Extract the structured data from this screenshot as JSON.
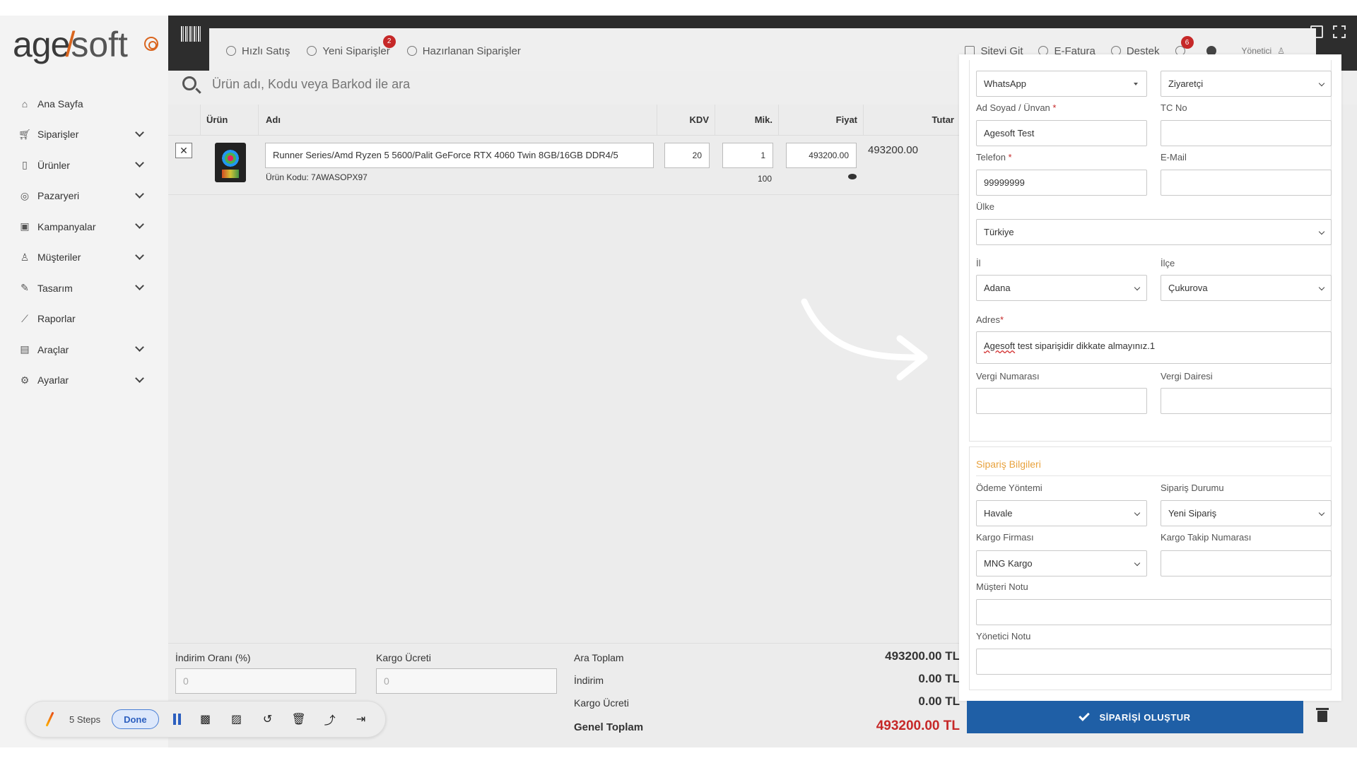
{
  "sidebar": {
    "logo_main": "age",
    "logo_slash": "/",
    "logo_soft": "soft",
    "items": [
      {
        "label": "Ana Sayfa",
        "icon": "home-icon",
        "expandable": false
      },
      {
        "label": "Siparişler",
        "icon": "cart-icon",
        "expandable": true
      },
      {
        "label": "Ürünler",
        "icon": "book-icon",
        "expandable": true
      },
      {
        "label": "Pazaryeri",
        "icon": "store-icon",
        "expandable": true
      },
      {
        "label": "Kampanyalar",
        "icon": "gift-icon",
        "expandable": true
      },
      {
        "label": "Müşteriler",
        "icon": "user-icon",
        "expandable": true
      },
      {
        "label": "Tasarım",
        "icon": "edit-icon",
        "expandable": true
      },
      {
        "label": "Raporlar",
        "icon": "chart-icon",
        "expandable": false
      },
      {
        "label": "Araçlar",
        "icon": "clipboard-icon",
        "expandable": true
      },
      {
        "label": "Ayarlar",
        "icon": "gear-icon",
        "expandable": true
      }
    ]
  },
  "toolbar": {
    "quick_sale": "Hızlı Satış",
    "new_orders": "Yeni Siparişler",
    "new_orders_badge": "2",
    "prepared_orders": "Hazırlanan Siparişler",
    "go_site": "Siteyi Git",
    "e_invoice": "E-Fatura",
    "support": "Destek",
    "notif_badge": "6",
    "user": "Yönetici"
  },
  "search": {
    "placeholder": "Ürün adı, Kodu veya Barkod ile ara"
  },
  "table": {
    "headers": {
      "urun": "Ürün",
      "adi": "Adı",
      "kdv": "KDV",
      "mik": "Mik.",
      "fiyat": "Fiyat",
      "tutar": "Tutar"
    },
    "rows": [
      {
        "name": "Runner Series/Amd Ryzen 5 5600/Palit GeForce RTX 4060 Twin 8GB/16GB DDR4/5",
        "code": "Ürün Kodu: 7AWASOPX97",
        "kdv": "20",
        "qty": "1",
        "stock": "100",
        "price": "493200.00",
        "total": "493200.00"
      }
    ]
  },
  "totals": {
    "discount_label": "İndirim Oranı (%)",
    "discount_value": "0",
    "shipping_fee_label": "Kargo Ücreti",
    "shipping_fee_value": "0",
    "subtotal_label": "Ara Toplam",
    "subtotal": "493200.00 TL",
    "discount_row_label": "İndirim",
    "discount_amount": "0.00 TL",
    "shipping_row_label": "Kargo Ücreti",
    "shipping_amount": "0.00 TL",
    "grand_label": "Genel Toplam",
    "grand_total": "493200.00 TL"
  },
  "customer": {
    "source": "WhatsApp",
    "type": "Ziyaretçi",
    "name_label": "Ad Soyad / Ünvan",
    "name": "Agesoft Test",
    "tc_label": "TC No",
    "tc": "",
    "phone_label": "Telefon",
    "phone": "99999999",
    "email_label": "E-Mail",
    "email": "",
    "country_label": "Ülke",
    "country": "Türkiye",
    "city_label": "İl",
    "city": "Adana",
    "district_label": "İlçe",
    "district": "Çukurova",
    "address_label": "Adres",
    "address_first": "Agesoft",
    "address_rest": " test siparişidir dikkate almayınız.1",
    "tax_no_label": "Vergi Numarası",
    "tax_no": "",
    "tax_office_label": "Vergi Dairesi",
    "tax_office": ""
  },
  "order": {
    "section_title": "Sipariş Bilgileri",
    "payment_label": "Ödeme Yöntemi",
    "payment": "Havale",
    "status_label": "Sipariş Durumu",
    "status": "Yeni Sipariş",
    "cargo_label": "Kargo Firması",
    "cargo": "MNG Kargo",
    "tracking_label": "Kargo Takip Numarası",
    "tracking": "",
    "customer_note_label": "Müşteri Notu",
    "admin_note_label": "Yönetici Notu"
  },
  "submit_label": "SİPARİŞİ OLUŞTUR",
  "recorder": {
    "steps": "5 Steps",
    "done": "Done"
  },
  "colors": {
    "accent": "#e8a23d",
    "primary_button": "#1f5fa6",
    "grand_total": "#c62828",
    "badge": "#c62828"
  }
}
